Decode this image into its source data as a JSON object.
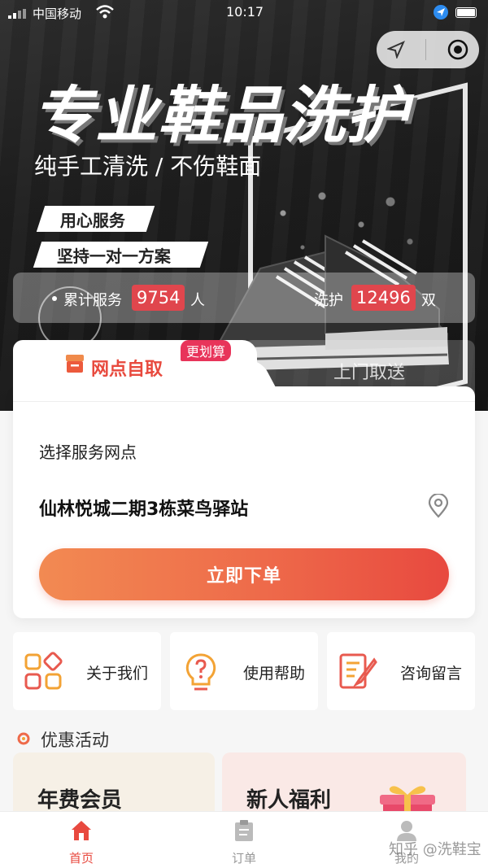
{
  "status_bar": {
    "carrier": "中国移动",
    "time": "10:17"
  },
  "hero": {
    "title": "专业鞋品洗护",
    "subtitle": "纯手工清洗 / 不伤鞋面",
    "tag1": "用心服务",
    "tag2": "坚持一对一方案",
    "stats": {
      "served_label": "累计服务",
      "served_value": "9754",
      "served_unit": "人",
      "washed_label": "洗护",
      "washed_value": "12496",
      "washed_unit": "双"
    }
  },
  "service_tabs": {
    "pickup_label": "网点自取",
    "pickup_badge": "更划算",
    "delivery_label": "上门取送"
  },
  "order_card": {
    "select_label": "选择服务网点",
    "selected_station": "仙林悦城二期3栋菜鸟驿站",
    "order_button": "立即下单"
  },
  "quick_links": [
    {
      "label": "关于我们",
      "icon": "apps-grid-icon"
    },
    {
      "label": "使用帮助",
      "icon": "lightbulb-help-icon"
    },
    {
      "label": "咨询留言",
      "icon": "note-edit-icon"
    }
  ],
  "promotions": {
    "heading": "优惠活动",
    "cards": [
      {
        "title": "年费会员"
      },
      {
        "title": "新人福利"
      }
    ]
  },
  "tab_bar": {
    "items": [
      {
        "label": "首页",
        "icon": "home-icon",
        "active": true
      },
      {
        "label": "订单",
        "icon": "clipboard-icon",
        "active": false
      },
      {
        "label": "我的",
        "icon": "user-icon",
        "active": false
      }
    ]
  },
  "watermark": "知乎 @洗鞋宝",
  "colors": {
    "accent": "#e8493f",
    "badge": "#e8345a",
    "stat_highlight": "#e0464d"
  }
}
